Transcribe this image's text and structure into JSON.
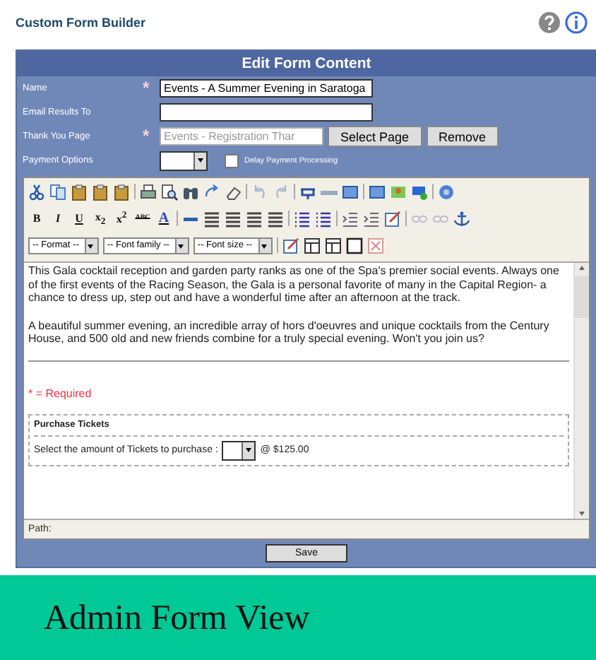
{
  "header": {
    "title": "Custom Form Builder"
  },
  "panel": {
    "title": "Edit Form Content",
    "required_mark": "*",
    "fields": [
      {
        "label": "Name",
        "required": true,
        "value": "Events - A Summer Evening in Saratoga",
        "kind": "text"
      },
      {
        "label": "Email Results To",
        "required": false,
        "kind": "text"
      },
      {
        "label": "Thank You Page",
        "required": true,
        "value": "Events - Registration Thar",
        "kind": "page",
        "disabled": true,
        "buttons": [
          "Select Page",
          "Remove"
        ]
      },
      {
        "label": "Payment Options",
        "required": false,
        "kind": "select",
        "checkbox": {
          "label": "Delay Payment Processing",
          "checked": false
        }
      }
    ]
  },
  "editor": {
    "text_buttons": [
      {
        "label": "B",
        "kind": "bold"
      },
      {
        "label": "I",
        "kind": "italic"
      },
      {
        "label": "U",
        "kind": "underline"
      },
      {
        "label": "x$_{2}$",
        "kind": "plain"
      },
      {
        "label": "x$^{2}$",
        "kind": "plain"
      },
      {
        "label": "ABC",
        "kind": "strike"
      },
      {
        "label": "A",
        "kind": "color"
      }
    ],
    "selects": [
      "-- Format --",
      "-- Font family --",
      "-- Font size --"
    ],
    "paragraphs": [
      "This Gala cocktail reception and garden party ranks as one of the Spa's premier social events. Always one of the first events of the Racing Season, the Gala is a personal favorite of many in the Capital Region- a chance to dress up, step out and have a wonderful time after an afternoon at the track.",
      "A beautiful summer evening, an incredible array of hors d'oeuvres and unique cocktails from the Century House, and 500 old and new friends combine for a truly special evening. Won't you join us?"
    ],
    "required_note": "* = Required",
    "section_title": "Purchase Tickets",
    "ticket_prompt": "Select the amount of Tickets to purchase :",
    "ticket_price": "@ $125.00",
    "path_label": "Path:"
  },
  "save_button": "Save",
  "banner": "Admin Form View"
}
